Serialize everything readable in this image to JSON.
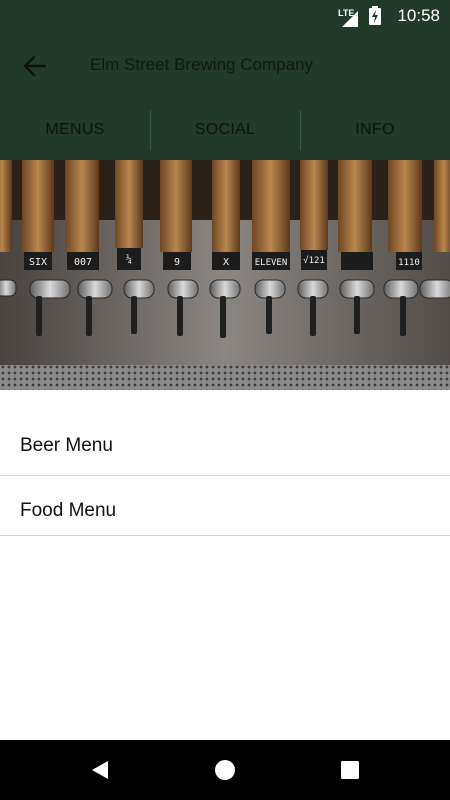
{
  "status_bar": {
    "time": "10:58",
    "network_label": "LTE",
    "icons": [
      "signal-icon",
      "battery-charging-icon"
    ]
  },
  "app_bar": {
    "title": "Elm Street Brewing Company",
    "back_icon": "arrow-left-icon"
  },
  "tabs": [
    {
      "label": "MENUS"
    },
    {
      "label": "SOCIAL"
    },
    {
      "label": "INFO"
    }
  ],
  "hero": {
    "tap_labels": [
      "SIX",
      "007",
      "¼",
      "9",
      "X",
      "ELEVEN",
      "√121",
      "",
      "1110"
    ]
  },
  "menu": {
    "items": [
      {
        "label": "Beer Menu"
      },
      {
        "label": "Food Menu"
      }
    ]
  },
  "colors": {
    "header_bg": "#213a29",
    "background": "#ffffff",
    "divider": "#d7d7d7",
    "nav_bg": "#000000"
  },
  "nav_bar": {
    "icons": [
      "back-triangle-icon",
      "home-circle-icon",
      "recents-square-icon"
    ]
  }
}
